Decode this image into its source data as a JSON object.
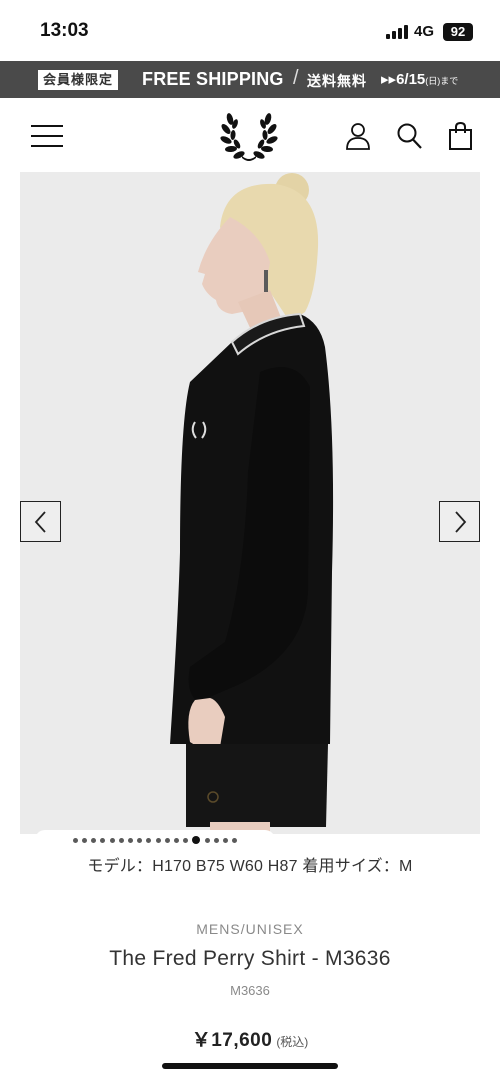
{
  "status_bar": {
    "time": "13:03",
    "network": "4G",
    "battery": "92"
  },
  "promo": {
    "badge": "会員様限定",
    "main": "FREE SHIPPING",
    "slash": "/",
    "jp_text": "送料無料",
    "date_text": "6/15",
    "date_suffix": "(日)まで"
  },
  "header": {
    "icons": [
      "menu-icon",
      "laurel-logo",
      "user-icon",
      "search-icon",
      "bag-icon"
    ]
  },
  "gallery": {
    "image_alt": "model wearing black long sleeve shirt",
    "slide_count": 18,
    "active_slide": 13
  },
  "model_info": "モデル：H170 B75 W60 H87 着用サイズ：M",
  "product": {
    "category": "MENS/UNISEX",
    "title": "The Fred Perry Shirt - M3636",
    "code": "M3636",
    "price": "￥17,600",
    "tax_note": "(税込)"
  }
}
